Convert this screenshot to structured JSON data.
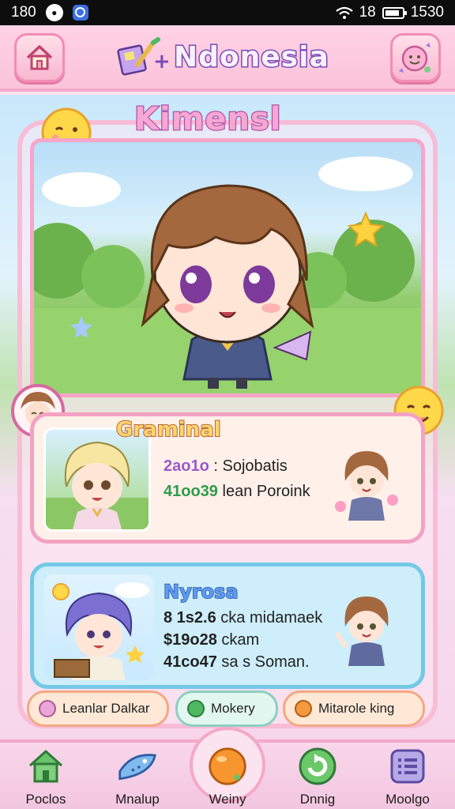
{
  "status_bar": {
    "time_left": "180",
    "time_right": "1530",
    "signal": "18"
  },
  "header": {
    "title": "Ndonesia"
  },
  "scene": {
    "label": "Kimensl"
  },
  "panel1": {
    "title": "Graminal",
    "line1_num": "2ao1o",
    "line1_text": ": Sojobatis",
    "line2_num": "41oo39",
    "line2_text": "lean  Poroink"
  },
  "panel2": {
    "title": "Nyrosa",
    "line1_num": "8 1s2.6",
    "line1_text": "cka  midamaek",
    "line2_num": "$19o28",
    "line2_text": "ckam",
    "line3_num": "41co47",
    "line3_text": "sa s Soman."
  },
  "chips": [
    {
      "label": "Leanlar Dalkar",
      "color": "#e9a6d6"
    },
    {
      "label": "Mokery",
      "color": "#4fb862"
    },
    {
      "label": "Mitarole king",
      "color": "#f59a3c"
    }
  ],
  "nav": [
    {
      "label": "Poclos",
      "icon": "home-icon"
    },
    {
      "label": "Mnalup",
      "icon": "fish-icon"
    },
    {
      "label": "Weiny",
      "icon": "orange-icon"
    },
    {
      "label": "Dnnig",
      "icon": "refresh-icon"
    },
    {
      "label": "Moolgo",
      "icon": "list-icon"
    }
  ]
}
